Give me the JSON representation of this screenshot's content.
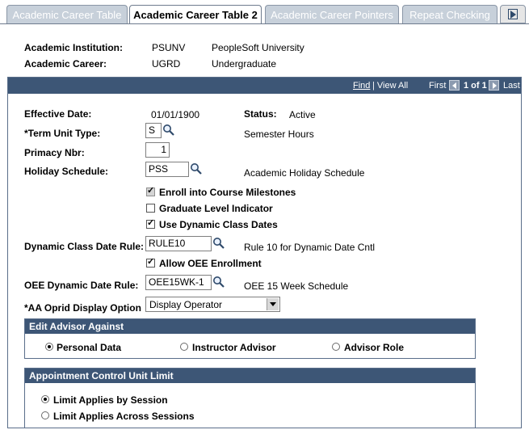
{
  "tabs": [
    {
      "label": "Academic Career Table",
      "active": false
    },
    {
      "label": "Academic Career Table 2",
      "active": true
    },
    {
      "label": "Academic Career Pointers",
      "active": false
    },
    {
      "label": "Repeat Checking",
      "active": false
    }
  ],
  "header": {
    "institution_label": "Academic Institution:",
    "institution_code": "PSUNV",
    "institution_name": "PeopleSoft University",
    "career_label": "Academic Career:",
    "career_code": "UGRD",
    "career_name": "Undergraduate"
  },
  "nav": {
    "find": "Find",
    "view_all": "| View All",
    "first": "First",
    "position": "1 of 1",
    "last": "Last"
  },
  "form": {
    "effective_date_label": "Effective Date:",
    "effective_date": "01/01/1900",
    "status_label": "Status:",
    "status": "Active",
    "term_unit_label": "*Term Unit Type:",
    "term_unit_value": "S",
    "term_unit_desc": "Semester Hours",
    "primacy_label": "Primacy Nbr:",
    "primacy_value": "1",
    "holiday_label": "Holiday Schedule:",
    "holiday_value": "PSS",
    "holiday_desc": "Academic Holiday Schedule",
    "checkbox_enroll": "Enroll into Course Milestones",
    "checkbox_graduate": "Graduate Level Indicator",
    "checkbox_dynamic": "Use Dynamic Class Dates",
    "dynamic_rule_label": "Dynamic Class Date Rule:",
    "dynamic_rule_value": "RULE10",
    "dynamic_rule_desc": "Rule 10 for Dynamic Date Cntl",
    "checkbox_oee": "Allow OEE Enrollment",
    "oee_rule_label": "OEE Dynamic Date Rule:",
    "oee_rule_value": "OEE15WK-1",
    "oee_rule_desc": "OEE 15 Week Schedule",
    "aa_label": "*AA Oprid Display Option",
    "aa_value": "Display Operator"
  },
  "checkbox_states": {
    "enroll": true,
    "graduate": false,
    "dynamic": true,
    "oee": true
  },
  "edit_advisor": {
    "title": "Edit Advisor Against",
    "options": [
      "Personal Data",
      "Instructor Advisor",
      "Advisor Role"
    ],
    "selected": "Personal Data"
  },
  "appointment": {
    "title": "Appointment Control Unit Limit",
    "options": [
      "Limit Applies by Session",
      "Limit Applies Across Sessions"
    ],
    "selected": "Limit Applies by Session"
  },
  "colors": {
    "header_bar": "#3d5676",
    "tab_inactive": "#c7d0da"
  },
  "icons": {
    "lookup": "magnifier-icon",
    "next_tabs": "next-tab-arrow-icon",
    "first": "left-arrow-icon",
    "last": "right-arrow-icon"
  }
}
